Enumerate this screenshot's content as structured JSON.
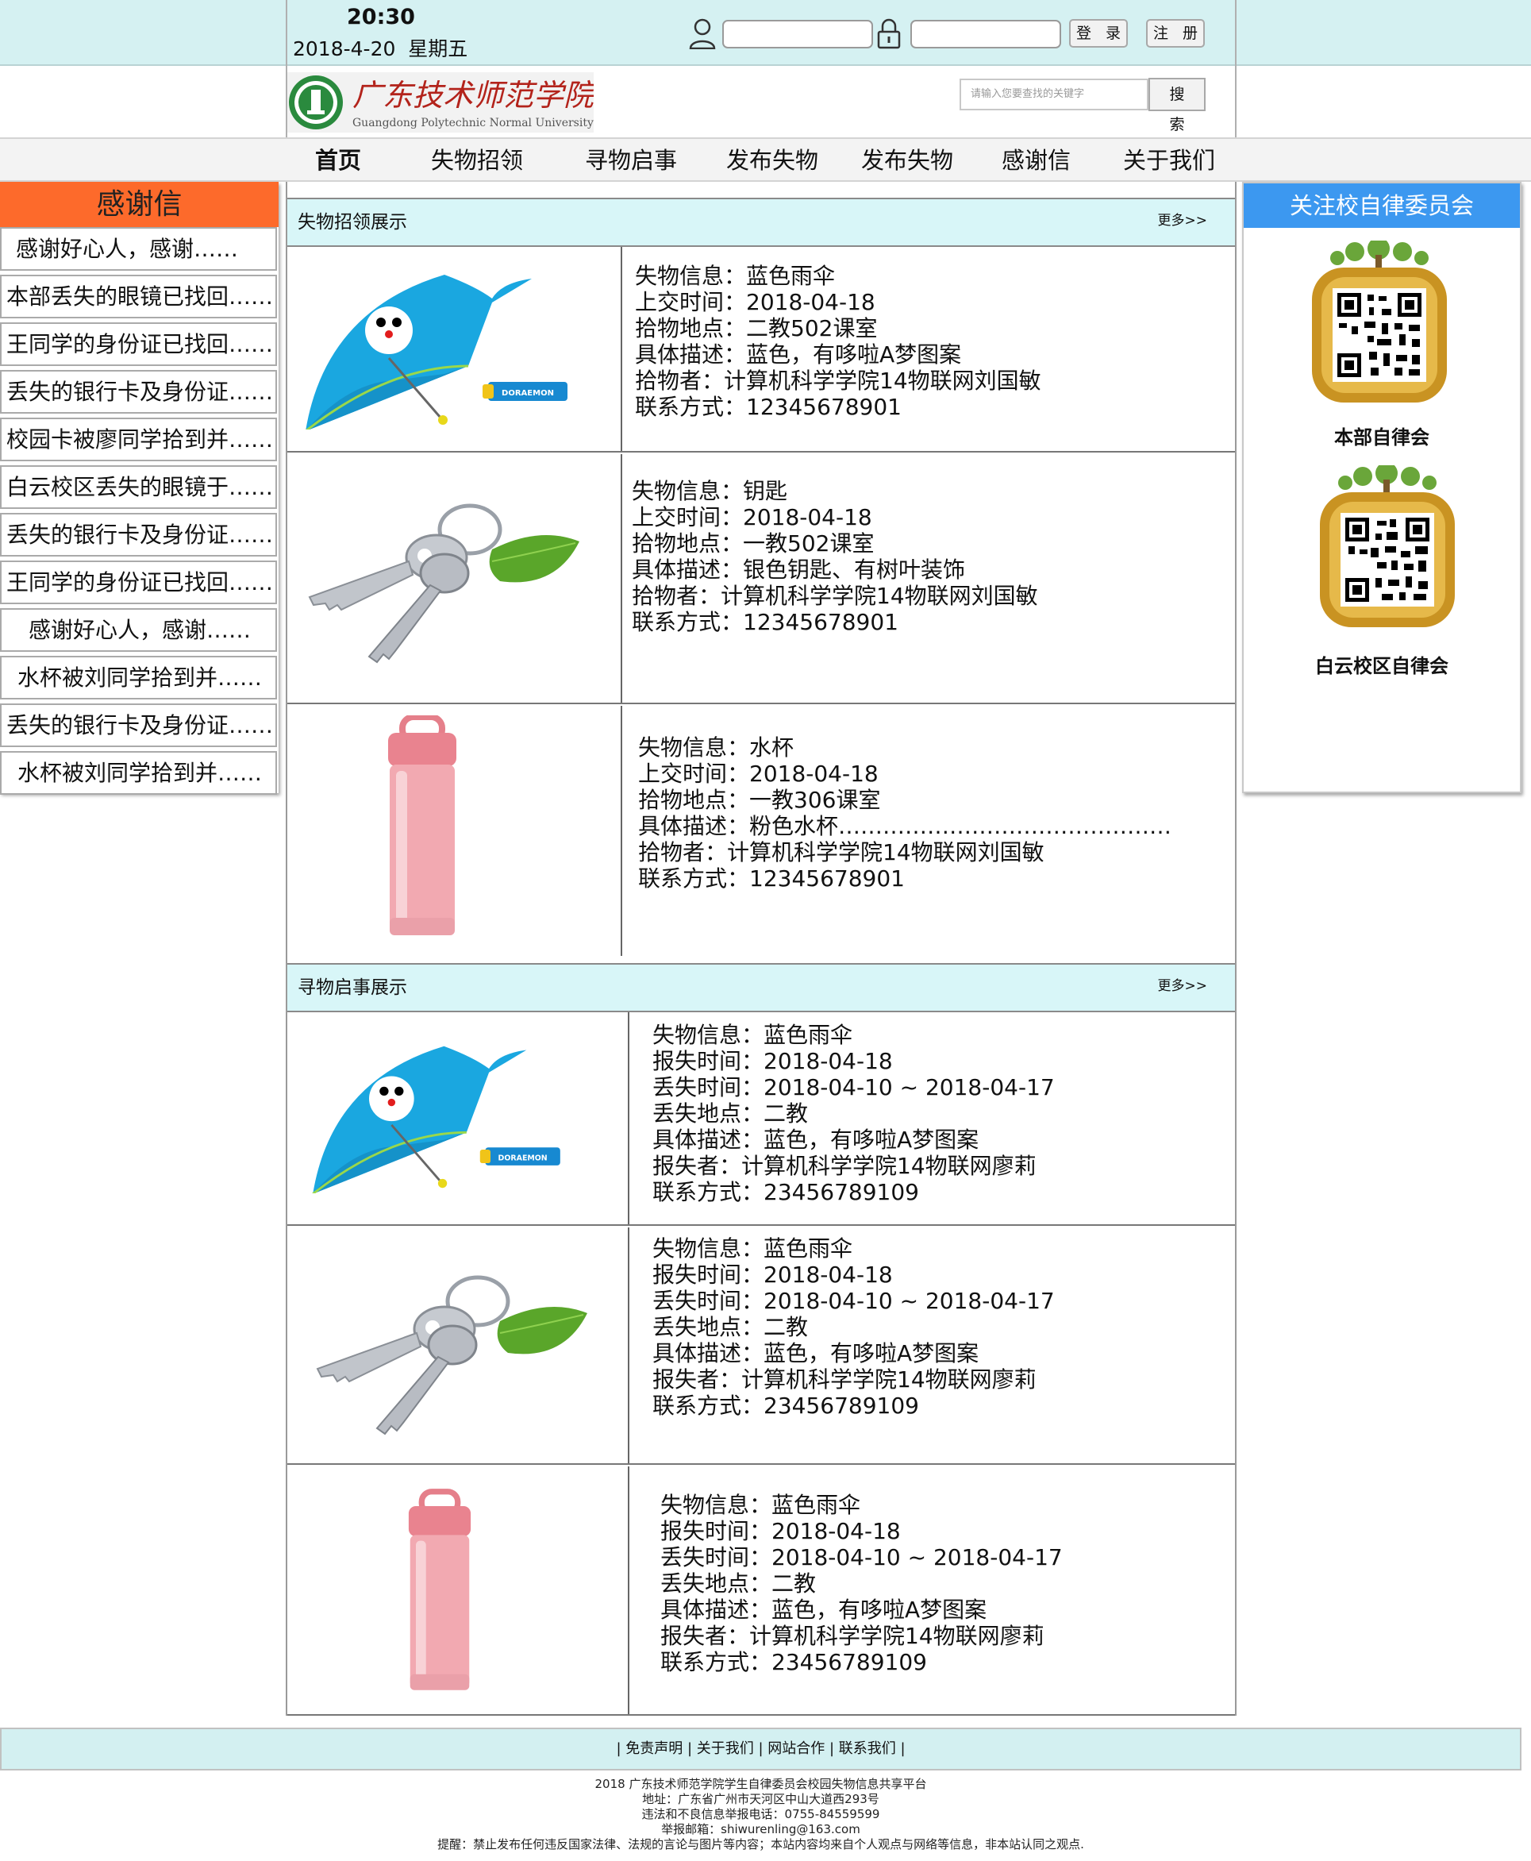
{
  "topbar": {
    "time": "20:30",
    "date": "2018-4-20",
    "weekday": "星期五",
    "username_value": "",
    "password_value": "",
    "login_label": "登 录",
    "register_label": "注 册"
  },
  "header": {
    "logo_cn": "广东技术师范学院",
    "logo_en": "Guangdong Polytechnic Normal University",
    "search_placeholder": "请输入您要查找的关键字",
    "search_label": "搜 索"
  },
  "nav": [
    "首页",
    "失物招领",
    "寻物启事",
    "发布失物",
    "发布失物",
    "感谢信",
    "关于我们"
  ],
  "thanks": {
    "title": "感谢信",
    "items": [
      "感谢好心人，感谢……",
      "本部丢失的眼镜已找回……",
      "王同学的身份证已找回……",
      "丢失的银行卡及身份证……",
      "校园卡被廖同学拾到并……",
      "白云校区丢失的眼镜于……",
      "丢失的银行卡及身份证……",
      "王同学的身份证已找回……",
      "感谢好心人，感谢……",
      "水杯被刘同学拾到并……",
      "丢失的银行卡及身份证……",
      "水杯被刘同学拾到并……"
    ]
  },
  "found": {
    "title": "失物招领展示",
    "more": "更多>>",
    "items": [
      {
        "image": "umbrella-image",
        "lines": [
          "失物信息：蓝色雨伞",
          "上交时间：2018-04-18",
          "拾物地点：二教502课室",
          "具体描述：蓝色，有哆啦A梦图案",
          "拾物者：计算机科学学院14物联网刘国敏",
          "联系方式：12345678901"
        ]
      },
      {
        "image": "keys-image",
        "lines": [
          "失物信息：钥匙",
          "上交时间：2018-04-18",
          "拾物地点：一教502课室",
          "具体描述：银色钥匙、有树叶装饰",
          "拾物者：计算机科学学院14物联网刘国敏",
          "联系方式：12345678901"
        ]
      },
      {
        "image": "cup-image",
        "lines": [
          "失物信息：水杯",
          "上交时间：2018-04-18",
          "拾物地点：一教306课室",
          "具体描述：粉色水杯………………………………………",
          "拾物者：计算机科学学院14物联网刘国敏",
          "联系方式：12345678901"
        ]
      }
    ]
  },
  "lost": {
    "title": "寻物启事展示",
    "more": "更多>>",
    "items": [
      {
        "image": "umbrella-image",
        "lines": [
          "失物信息：蓝色雨伞",
          "报失时间：2018-04-18",
          "丢失时间：2018-04-10 ~ 2018-04-17",
          "丢失地点：二教",
          "具体描述：蓝色，有哆啦A梦图案",
          "报失者：计算机科学学院14物联网廖莉",
          "联系方式：23456789109"
        ]
      },
      {
        "image": "keys-image",
        "lines": [
          "失物信息：蓝色雨伞",
          "报失时间：2018-04-18",
          "丢失时间：2018-04-10 ~ 2018-04-17",
          "丢失地点：二教",
          "具体描述：蓝色，有哆啦A梦图案",
          "报失者：计算机科学学院14物联网廖莉",
          "联系方式：23456789109"
        ]
      },
      {
        "image": "cup-image",
        "lines": [
          "失物信息：蓝色雨伞",
          "报失时间：2018-04-18",
          "丢失时间：2018-04-10 ~ 2018-04-17",
          "丢失地点：二教",
          "具体描述：蓝色，有哆啦A梦图案",
          "报失者：计算机科学学院14物联网廖莉",
          "联系方式：23456789109"
        ]
      }
    ]
  },
  "right": {
    "title": "关注校自律委员会",
    "qr1_label": "本部自律会",
    "qr2_label": "白云校区自律会"
  },
  "footer": {
    "links": "| 免责声明 | 关于我们 | 网站合作 | 联系我们 |",
    "lines": [
      "2018 广东技术师范学院学生自律委员会校园失物信息共享平台",
      "地址：广东省广州市天河区中山大道西293号",
      "违法和不良信息举报电话：0755-84559599",
      "举报邮箱：shiwurenling@163.com",
      "提醒：禁止发布任何违反国家法律、法规的言论与图片等内容；本站内容均来自个人观点与网络等信息，非本站认同之观点."
    ]
  },
  "colors": {
    "topbar_bg": "#d5f1f2",
    "thanks_title_bg": "#fd6a2b",
    "right_title_bg": "#3c98f0",
    "section_head_bg": "#d8f6f8"
  }
}
